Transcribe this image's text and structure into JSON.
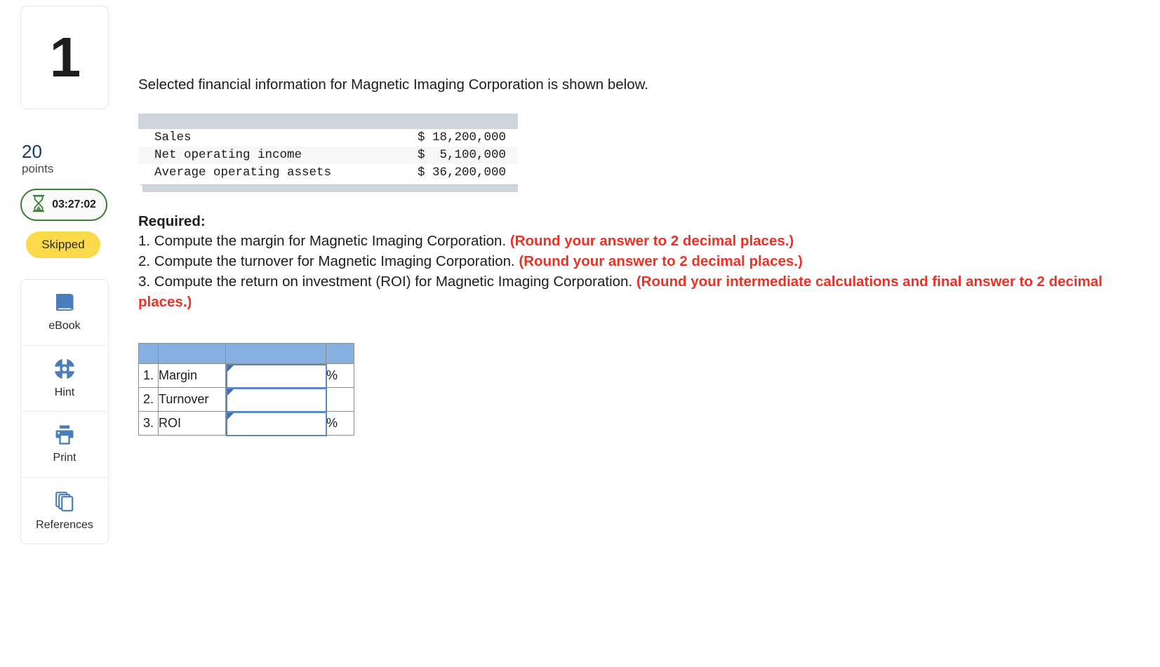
{
  "question": {
    "number": "1",
    "points_value": "20",
    "points_label": "points",
    "timer": "03:27:02",
    "status_badge": "Skipped"
  },
  "tools": [
    {
      "label": "eBook",
      "icon": "book-icon"
    },
    {
      "label": "Hint",
      "icon": "lifebuoy-icon"
    },
    {
      "label": "Print",
      "icon": "printer-icon"
    },
    {
      "label": "References",
      "icon": "copy-pages-icon"
    }
  ],
  "main": {
    "intro": "Selected financial information for Magnetic Imaging Corporation is shown below.",
    "financials": {
      "rows": [
        {
          "label": "Sales",
          "value": "$ 18,200,000"
        },
        {
          "label": "Net operating income",
          "value": "$  5,100,000"
        },
        {
          "label": "Average operating assets",
          "value": "$ 36,200,000"
        }
      ]
    },
    "required": {
      "title": "Required:",
      "items": [
        {
          "text": "1. Compute the margin for Magnetic Imaging Corporation. ",
          "emphasis": "(Round your answer to 2 decimal places.)"
        },
        {
          "text": "2. Compute the turnover for Magnetic Imaging Corporation. ",
          "emphasis": "(Round your answer to 2 decimal places.)"
        },
        {
          "text": "3. Compute the return on investment (ROI) for Magnetic Imaging Corporation. ",
          "emphasis": "(Round your intermediate calculations and final answer to 2 decimal places.)"
        }
      ]
    },
    "answer_table": {
      "header": [
        "",
        "",
        "",
        ""
      ],
      "rows": [
        {
          "num": "1.",
          "label": "Margin",
          "value": "",
          "unit": "%"
        },
        {
          "num": "2.",
          "label": "Turnover",
          "value": "",
          "unit": ""
        },
        {
          "num": "3.",
          "label": "ROI",
          "value": "",
          "unit": "%"
        }
      ]
    }
  },
  "colors": {
    "accent_blue": "#4a7ebb",
    "header_blue": "#85b0e0",
    "emphasis_red": "#ee3124",
    "skipped_yellow": "#fcd948",
    "timer_green": "#3f7d3f",
    "points_navy": "#1b3a6b"
  }
}
